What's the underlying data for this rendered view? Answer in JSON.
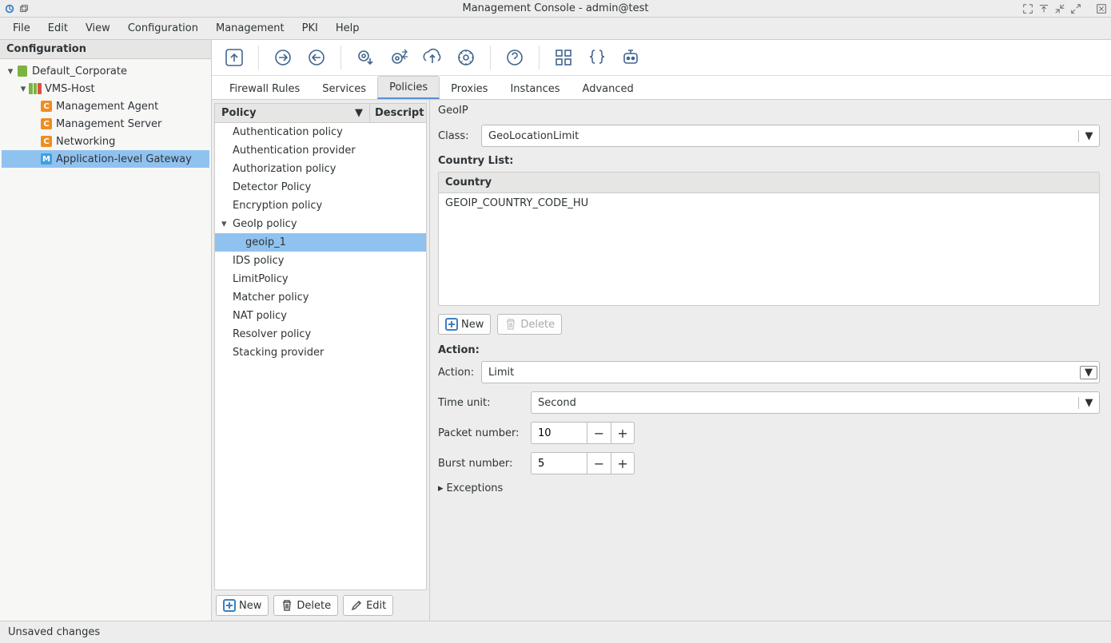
{
  "window": {
    "title": "Management Console - admin@test"
  },
  "menubar": [
    "File",
    "Edit",
    "View",
    "Configuration",
    "Management",
    "PKI",
    "Help"
  ],
  "sidebar": {
    "header": "Configuration",
    "tree": {
      "root": "Default_Corporate",
      "host": "VMS-Host",
      "children": [
        {
          "icon": "C",
          "label": "Management Agent"
        },
        {
          "icon": "C",
          "label": "Management Server"
        },
        {
          "icon": "C",
          "label": "Networking"
        },
        {
          "icon": "M",
          "label": "Application-level Gateway",
          "selected": true
        }
      ]
    }
  },
  "tabs": [
    "Firewall Rules",
    "Services",
    "Policies",
    "Proxies",
    "Instances",
    "Advanced"
  ],
  "tabs_active": 2,
  "policyPane": {
    "heading": "GeoIP",
    "columns": {
      "policy": "Policy",
      "description": "Descript"
    },
    "items": [
      "Authentication policy",
      "Authentication provider",
      "Authorization policy",
      "Detector Policy",
      "Encryption policy"
    ],
    "expanded": {
      "label": "GeoIp policy",
      "child": "geoip_1"
    },
    "after": [
      "IDS policy",
      "LimitPolicy",
      "Matcher policy",
      "NAT policy",
      "Resolver policy",
      "Stacking provider"
    ],
    "buttons": {
      "new": "New",
      "delete": "Delete",
      "edit": "Edit"
    }
  },
  "detail": {
    "classLabel": "Class:",
    "classValue": "GeoLocationLimit",
    "countryListLabel": "Country List:",
    "countryHeader": "Country",
    "countryValue": "GEOIP_COUNTRY_CODE_HU",
    "newBtn": "New",
    "deleteBtn": "Delete",
    "actionSection": "Action:",
    "actionLabel": "Action:",
    "actionValue": "Limit",
    "timeLabel": "Time unit:",
    "timeValue": "Second",
    "packetLabel": "Packet number:",
    "packetValue": "10",
    "burstLabel": "Burst number:",
    "burstValue": "5",
    "exceptions": "Exceptions"
  },
  "statusbar": "Unsaved changes"
}
